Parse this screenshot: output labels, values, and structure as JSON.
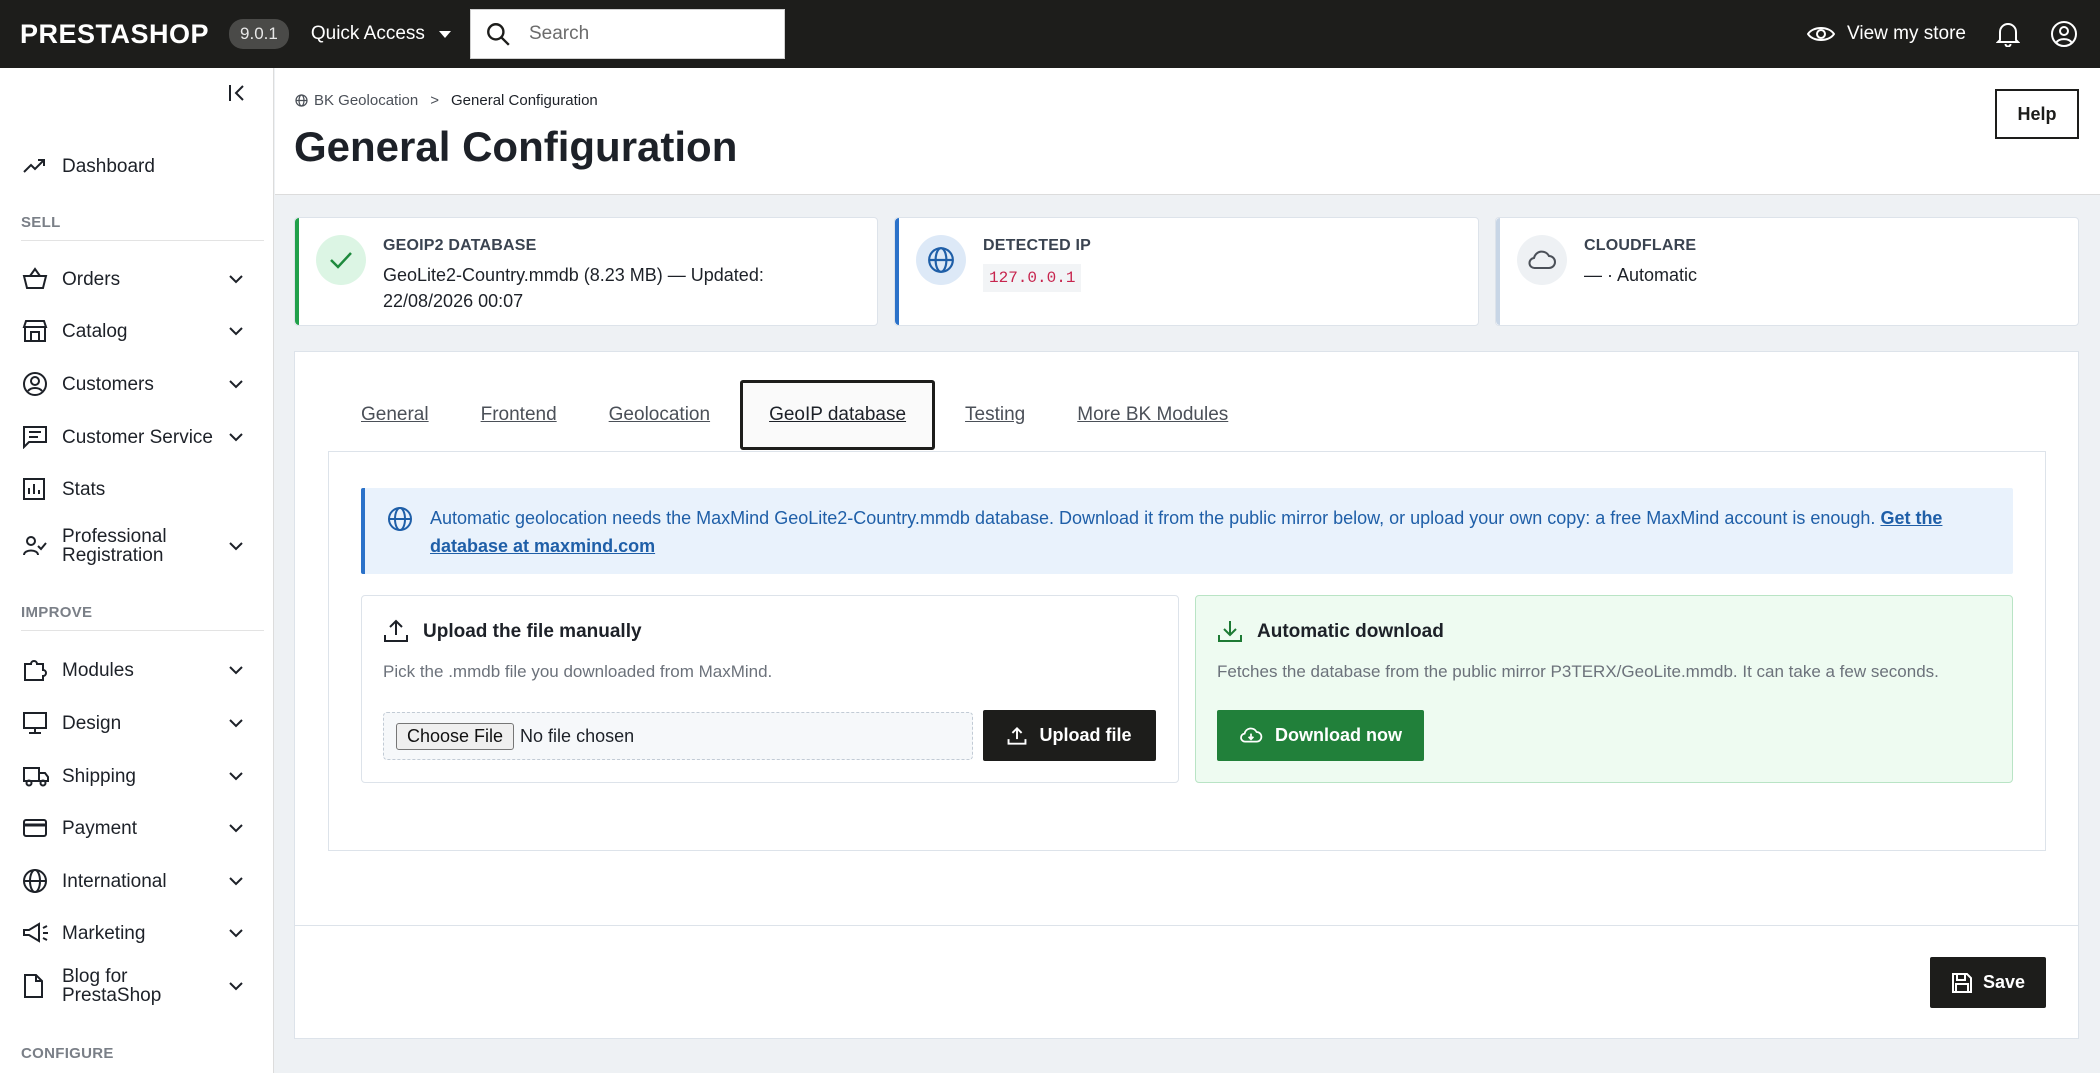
{
  "header": {
    "logo": "PRESTASHOP",
    "version": "9.0.1",
    "quick_access": "Quick Access",
    "search_placeholder": "Search",
    "view_store": "View my store"
  },
  "sidebar": {
    "dashboard": "Dashboard",
    "sections": {
      "sell": "SELL",
      "improve": "IMPROVE",
      "configure": "CONFIGURE"
    },
    "sell_items": [
      {
        "label": "Orders",
        "icon": "orders-icon"
      },
      {
        "label": "Catalog",
        "icon": "catalog-icon"
      },
      {
        "label": "Customers",
        "icon": "customers-icon"
      },
      {
        "label": "Customer Service",
        "icon": "customer-service-icon"
      },
      {
        "label": "Stats",
        "icon": "stats-icon"
      },
      {
        "label": "Professional Registration",
        "icon": "professional-registration-icon"
      }
    ],
    "improve_items": [
      {
        "label": "Modules",
        "icon": "modules-icon"
      },
      {
        "label": "Design",
        "icon": "design-icon"
      },
      {
        "label": "Shipping",
        "icon": "shipping-icon"
      },
      {
        "label": "Payment",
        "icon": "payment-icon"
      },
      {
        "label": "International",
        "icon": "international-icon"
      },
      {
        "label": "Marketing",
        "icon": "marketing-icon"
      },
      {
        "label": "Blog for PrestaShop",
        "icon": "blog-icon"
      }
    ]
  },
  "page": {
    "breadcrumb_parent": "BK Geolocation",
    "breadcrumb_sep": ">",
    "breadcrumb_current": "General Configuration",
    "title": "General Configuration",
    "help": "Help"
  },
  "status_cards": {
    "geoip": {
      "title": "GEOIP2 DATABASE",
      "value": "GeoLite2-Country.mmdb (8.23 MB) — Updated: 22/08/2026 00:07",
      "accent": "#21a04a"
    },
    "ip": {
      "title": "DETECTED IP",
      "value": "127.0.0.1",
      "accent": "#2b72c9"
    },
    "cloudflare": {
      "title": "CLOUDFLARE",
      "value": "— · Automatic",
      "accent": "#c8d6e6"
    }
  },
  "tabs": [
    {
      "label": "General",
      "active": false
    },
    {
      "label": "Frontend",
      "active": false
    },
    {
      "label": "Geolocation",
      "active": false
    },
    {
      "label": "GeoIP database",
      "active": true
    },
    {
      "label": "Testing",
      "active": false
    },
    {
      "label": "More BK Modules",
      "active": false
    }
  ],
  "alert": {
    "text": "Automatic geolocation needs the MaxMind GeoLite2-Country.mmdb database. Download it from the public mirror below, or upload your own copy: a free MaxMind account is enough. ",
    "link": "Get the database at maxmind.com"
  },
  "upload": {
    "title": "Upload the file manually",
    "desc": "Pick the .mmdb file you downloaded from MaxMind.",
    "choose": "Choose File",
    "no_file": "No file chosen",
    "button": "Upload file"
  },
  "auto_download": {
    "title": "Automatic download",
    "desc": "Fetches the database from the public mirror P3TERX/GeoLite.mmdb. It can take a few seconds.",
    "button": "Download now"
  },
  "save": "Save"
}
